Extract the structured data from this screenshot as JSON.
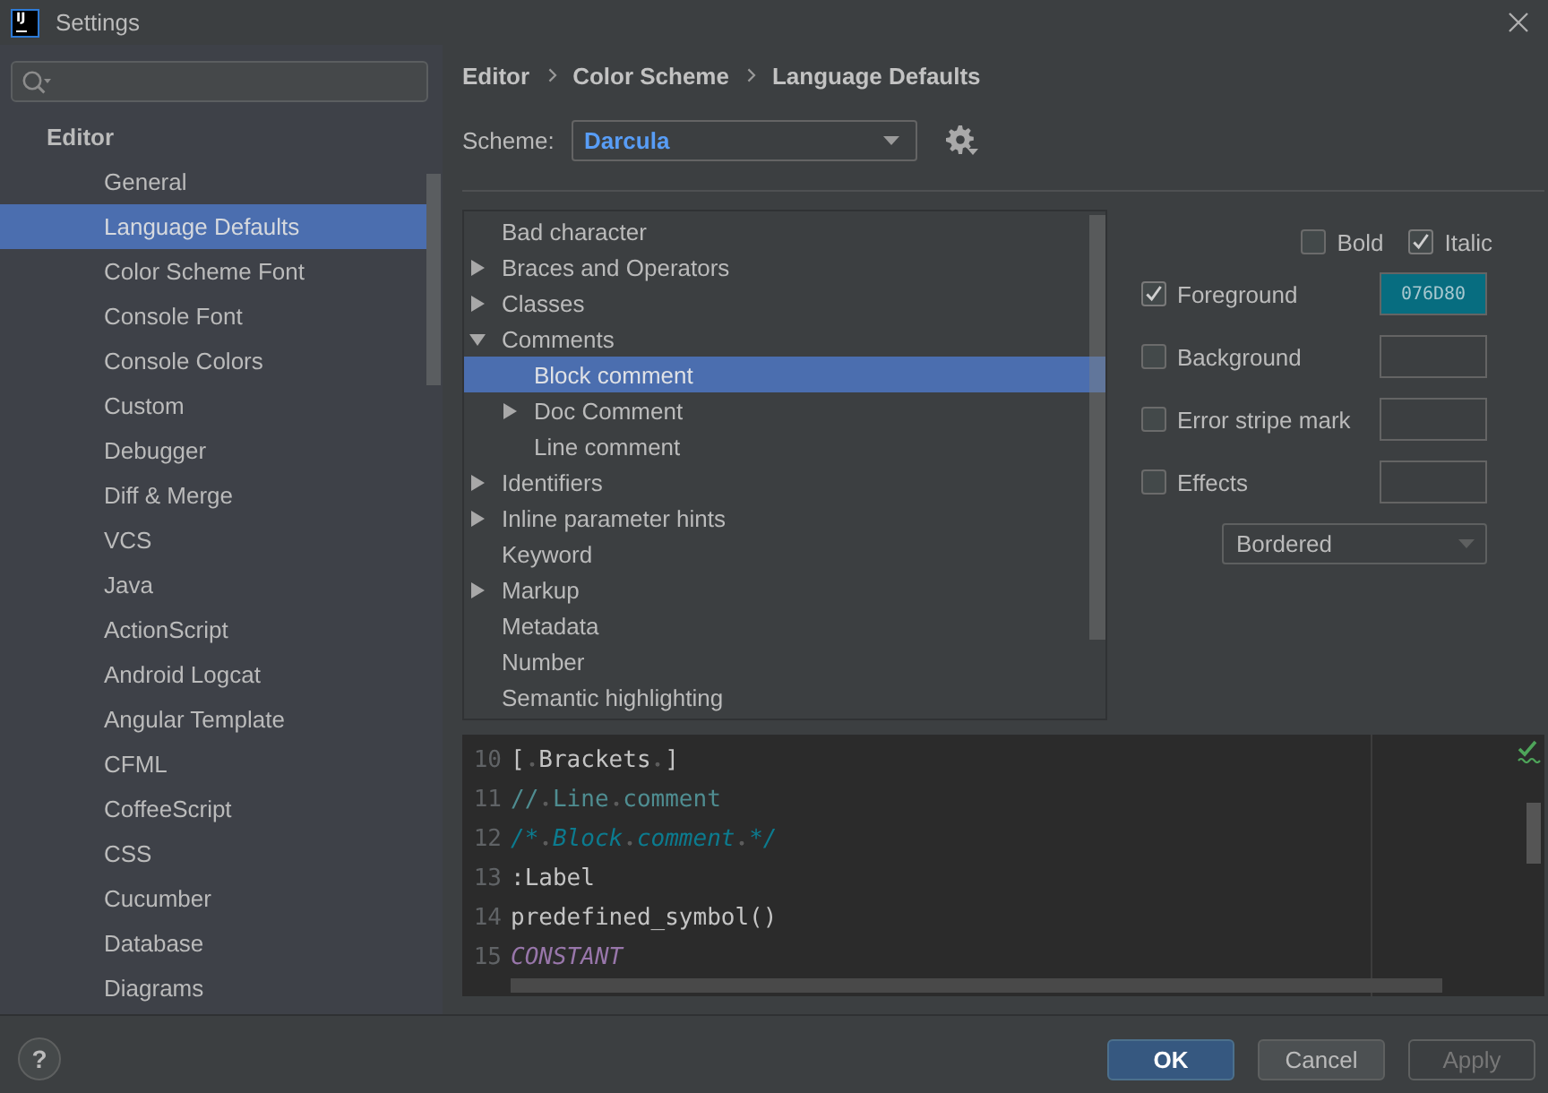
{
  "window": {
    "logo": "IJ",
    "title": "Settings"
  },
  "sidebar": {
    "items": [
      {
        "label": "Editor",
        "selected": false,
        "children": [
          {
            "label": "General",
            "selected": false
          },
          {
            "label": "Language Defaults",
            "selected": true
          },
          {
            "label": "Color Scheme Font",
            "selected": false
          },
          {
            "label": "Console Font",
            "selected": false
          },
          {
            "label": "Console Colors",
            "selected": false
          },
          {
            "label": "Custom",
            "selected": false
          },
          {
            "label": "Debugger",
            "selected": false
          },
          {
            "label": "Diff & Merge",
            "selected": false
          },
          {
            "label": "VCS",
            "selected": false
          },
          {
            "label": "Java",
            "selected": false
          },
          {
            "label": "ActionScript",
            "selected": false
          },
          {
            "label": "Android Logcat",
            "selected": false
          },
          {
            "label": "Angular Template",
            "selected": false
          },
          {
            "label": "CFML",
            "selected": false
          },
          {
            "label": "CoffeeScript",
            "selected": false
          },
          {
            "label": "CSS",
            "selected": false
          },
          {
            "label": "Cucumber",
            "selected": false
          },
          {
            "label": "Database",
            "selected": false
          },
          {
            "label": "Diagrams",
            "selected": false
          }
        ]
      }
    ]
  },
  "breadcrumb": [
    "Editor",
    "Color Scheme",
    "Language Defaults"
  ],
  "scheme": {
    "label": "Scheme:",
    "value": "Darcula"
  },
  "tree": {
    "items": [
      {
        "label": "Bad character",
        "selected": false
      },
      {
        "label": "Braces and Operators",
        "expanded": false,
        "selected": false
      },
      {
        "label": "Classes",
        "expanded": false,
        "selected": false
      },
      {
        "label": "Comments",
        "expanded": true,
        "selected": false,
        "children": [
          {
            "label": "Block comment",
            "selected": true
          },
          {
            "label": "Doc Comment",
            "expanded": false,
            "selected": false
          },
          {
            "label": "Line comment",
            "selected": false
          }
        ]
      },
      {
        "label": "Identifiers",
        "expanded": false,
        "selected": false
      },
      {
        "label": "Inline parameter hints",
        "expanded": false,
        "selected": false
      },
      {
        "label": "Keyword",
        "selected": false
      },
      {
        "label": "Markup",
        "expanded": false,
        "selected": false
      },
      {
        "label": "Metadata",
        "selected": false
      },
      {
        "label": "Number",
        "selected": false
      },
      {
        "label": "Semantic highlighting",
        "selected": false
      }
    ]
  },
  "font_style": [
    {
      "label": "Bold",
      "checked": false
    },
    {
      "label": "Italic",
      "checked": true
    }
  ],
  "attributes": [
    {
      "label": "Foreground",
      "checked": true,
      "value": "076D80",
      "color": "#076d80"
    },
    {
      "label": "Background",
      "checked": false
    },
    {
      "label": "Error stripe mark",
      "checked": false
    },
    {
      "label": "Effects",
      "checked": false
    }
  ],
  "effect_type": {
    "value": "Bordered"
  },
  "preview": {
    "lines": [
      {
        "number": "10",
        "text": "[ Brackets ]",
        "kind": "plain"
      },
      {
        "number": "11",
        "text": "// Line comment",
        "kind": "line_comment"
      },
      {
        "number": "12",
        "text": "/* Block comment */",
        "kind": "block_comment"
      },
      {
        "number": "13",
        "text": ":Label",
        "kind": "plain"
      },
      {
        "number": "14",
        "text": "predefined_symbol()",
        "kind": "plain"
      },
      {
        "number": "15",
        "text": "CONSTANT",
        "kind": "constant"
      }
    ]
  },
  "help_button": {
    "label": "?"
  },
  "buttons": [
    {
      "label": "OK",
      "default": true,
      "disabled": false
    },
    {
      "label": "Cancel",
      "default": false,
      "disabled": false
    },
    {
      "label": "Apply",
      "default": false,
      "disabled": true
    }
  ]
}
